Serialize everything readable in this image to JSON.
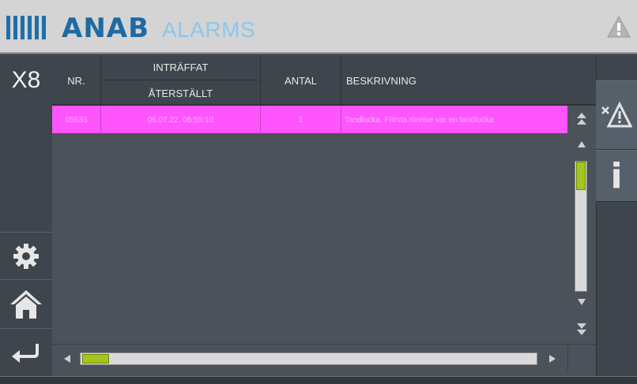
{
  "header": {
    "logo": "ANAB",
    "title": "ALARMS",
    "warning_icon": "warning-triangle-icon"
  },
  "station": {
    "label": "X8"
  },
  "left_rail": {
    "settings_icon": "gear-icon",
    "home_icon": "home-icon",
    "back_icon": "return-arrow-icon"
  },
  "table": {
    "columns": {
      "nr": "NR.",
      "occurred": "INTRÄFFAT",
      "reset": "ÅTERSTÄLLT",
      "count": "ANTAL",
      "description": "BESKRIVNING"
    },
    "rows": [
      {
        "nr": "05533",
        "time": "06.07.22. 06:55:10",
        "count": "1",
        "description": "Tandlucka. Första rörelse var en tandlucka",
        "color": "#ff55ff"
      }
    ]
  },
  "scrollbars": {
    "accent": "#a3c51c",
    "vertical_position": 0,
    "horizontal_position": 0
  },
  "right_rail": {
    "acknowledge_icon": "acknowledge-alarm-icon",
    "info_icon": "info-icon",
    "info_glyph": "i"
  }
}
